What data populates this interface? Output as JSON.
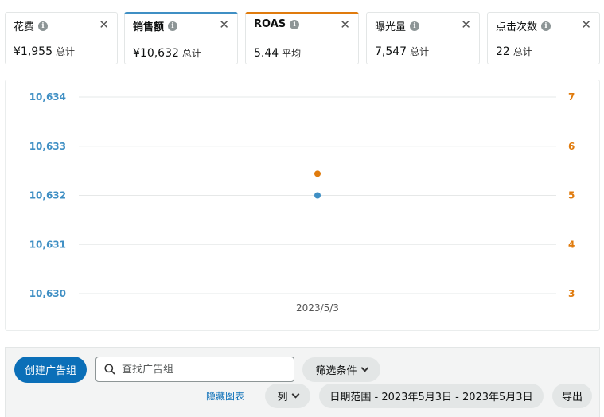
{
  "metrics": [
    {
      "title": "花费",
      "value": "¥1,955",
      "sub": "总计",
      "state": "inactive"
    },
    {
      "title": "销售额",
      "value": "¥10,632",
      "sub": "总计",
      "state": "active-blue"
    },
    {
      "title": "ROAS",
      "value": "5.44",
      "sub": "平均",
      "state": "active-orange"
    },
    {
      "title": "曝光量",
      "value": "7,547",
      "sub": "总计",
      "state": "inactive"
    },
    {
      "title": "点击次数",
      "value": "22",
      "sub": "总计",
      "state": "inactive"
    }
  ],
  "icons": {
    "info": "i",
    "close": "✕"
  },
  "chart_data": {
    "type": "scatter",
    "x": [
      "2023/5/3"
    ],
    "series": [
      {
        "color": "#3f8fc4",
        "axis": "left",
        "values": [
          10632
        ]
      },
      {
        "color": "#e07b0d",
        "axis": "right",
        "values": [
          5.44
        ]
      }
    ],
    "left_axis": {
      "ticks": [
        "10,634",
        "10,633",
        "10,632",
        "10,631",
        "10,630"
      ],
      "ylim": [
        10630,
        10634
      ],
      "color": "#3f8fc4"
    },
    "right_axis": {
      "ticks": [
        "7",
        "6",
        "5",
        "4",
        "3"
      ],
      "ylim": [
        3,
        7
      ],
      "color": "#e07b0d"
    },
    "grid": true
  },
  "toolbar": {
    "create_label": "创建广告组",
    "search_placeholder": "查找广告组",
    "filter_label": "筛选条件",
    "hide_chart_label": "隐藏图表",
    "columns_label": "列",
    "date_range_label": "日期范围 - 2023年5月3日 - 2023年5月3日",
    "export_label": "导出"
  }
}
